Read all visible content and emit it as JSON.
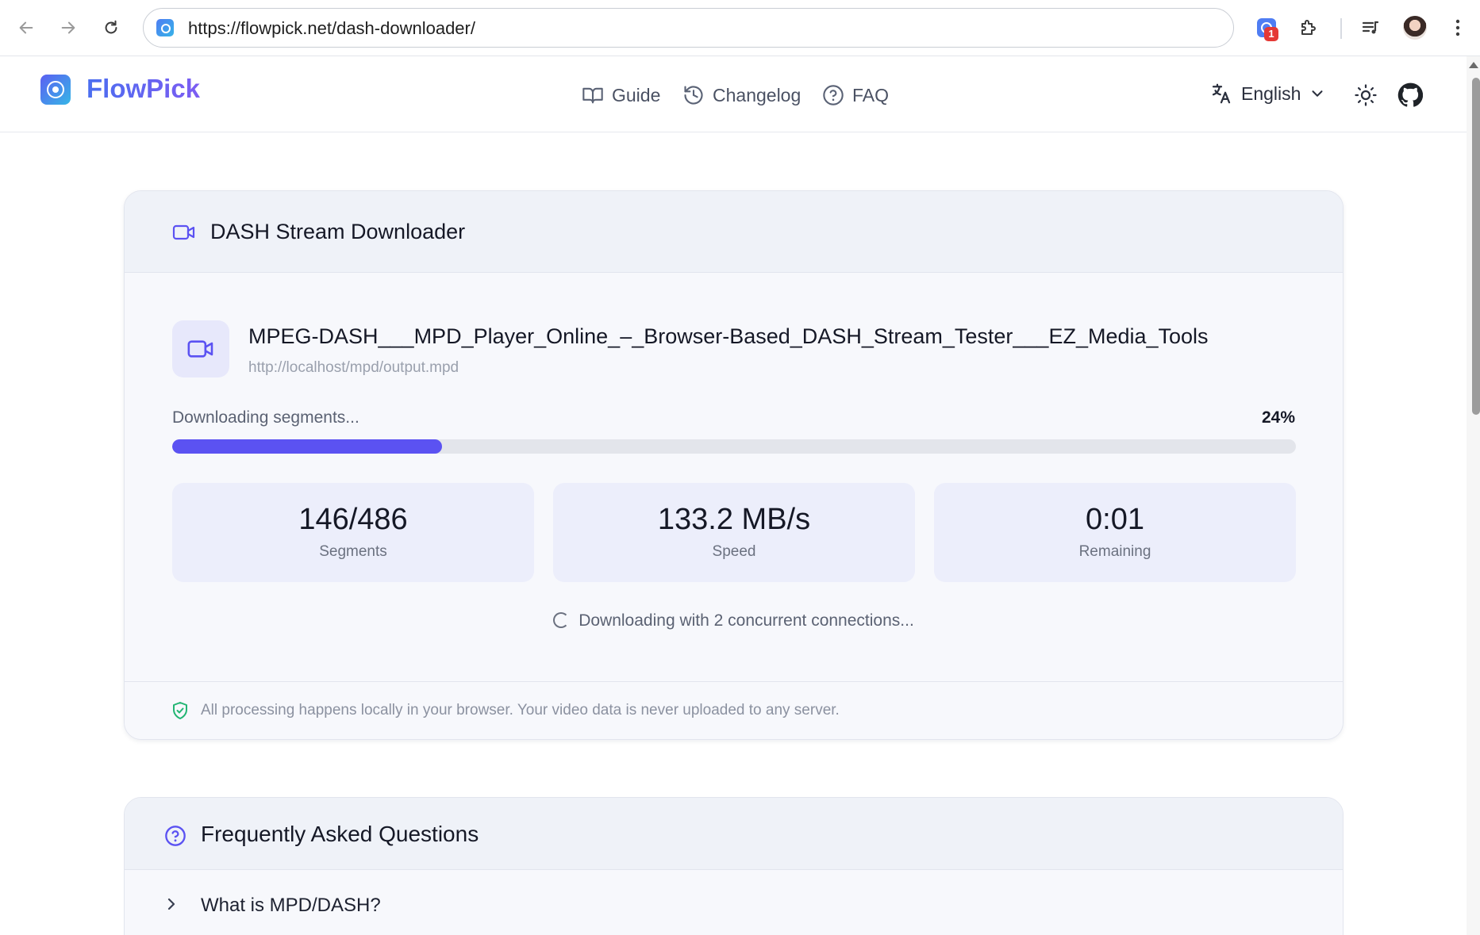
{
  "browser": {
    "url": "https://flowpick.net/dash-downloader/",
    "extension_badge": "1"
  },
  "header": {
    "logo_text": "FlowPick",
    "nav": [
      {
        "label": "Guide",
        "icon": "book-open-icon"
      },
      {
        "label": "Changelog",
        "icon": "history-icon"
      },
      {
        "label": "FAQ",
        "icon": "help-circle-icon"
      }
    ],
    "language": "English"
  },
  "downloader": {
    "title": "DASH Stream Downloader",
    "file_name": "MPEG-DASH___MPD_Player_Online_–_Browser-Based_DASH_Stream_Tester___EZ_Media_Tools",
    "source_url": "http://localhost/mpd/output.mpd",
    "status": "Downloading segments...",
    "progress_text": "24%",
    "progress": 0.24,
    "stats": [
      {
        "value": "146/486",
        "label": "Segments"
      },
      {
        "value": "133.2 MB/s",
        "label": "Speed"
      },
      {
        "value": "0:01",
        "label": "Remaining"
      }
    ],
    "connections_text": "Downloading with 2 concurrent connections...",
    "privacy_note": "All processing happens locally in your browser. Your video data is never uploaded to any server."
  },
  "faq": {
    "title": "Frequently Asked Questions",
    "items": [
      {
        "question": "What is MPD/DASH?"
      }
    ]
  },
  "colors": {
    "accent": "#5b52f2",
    "privacy_shield": "#22b573"
  }
}
